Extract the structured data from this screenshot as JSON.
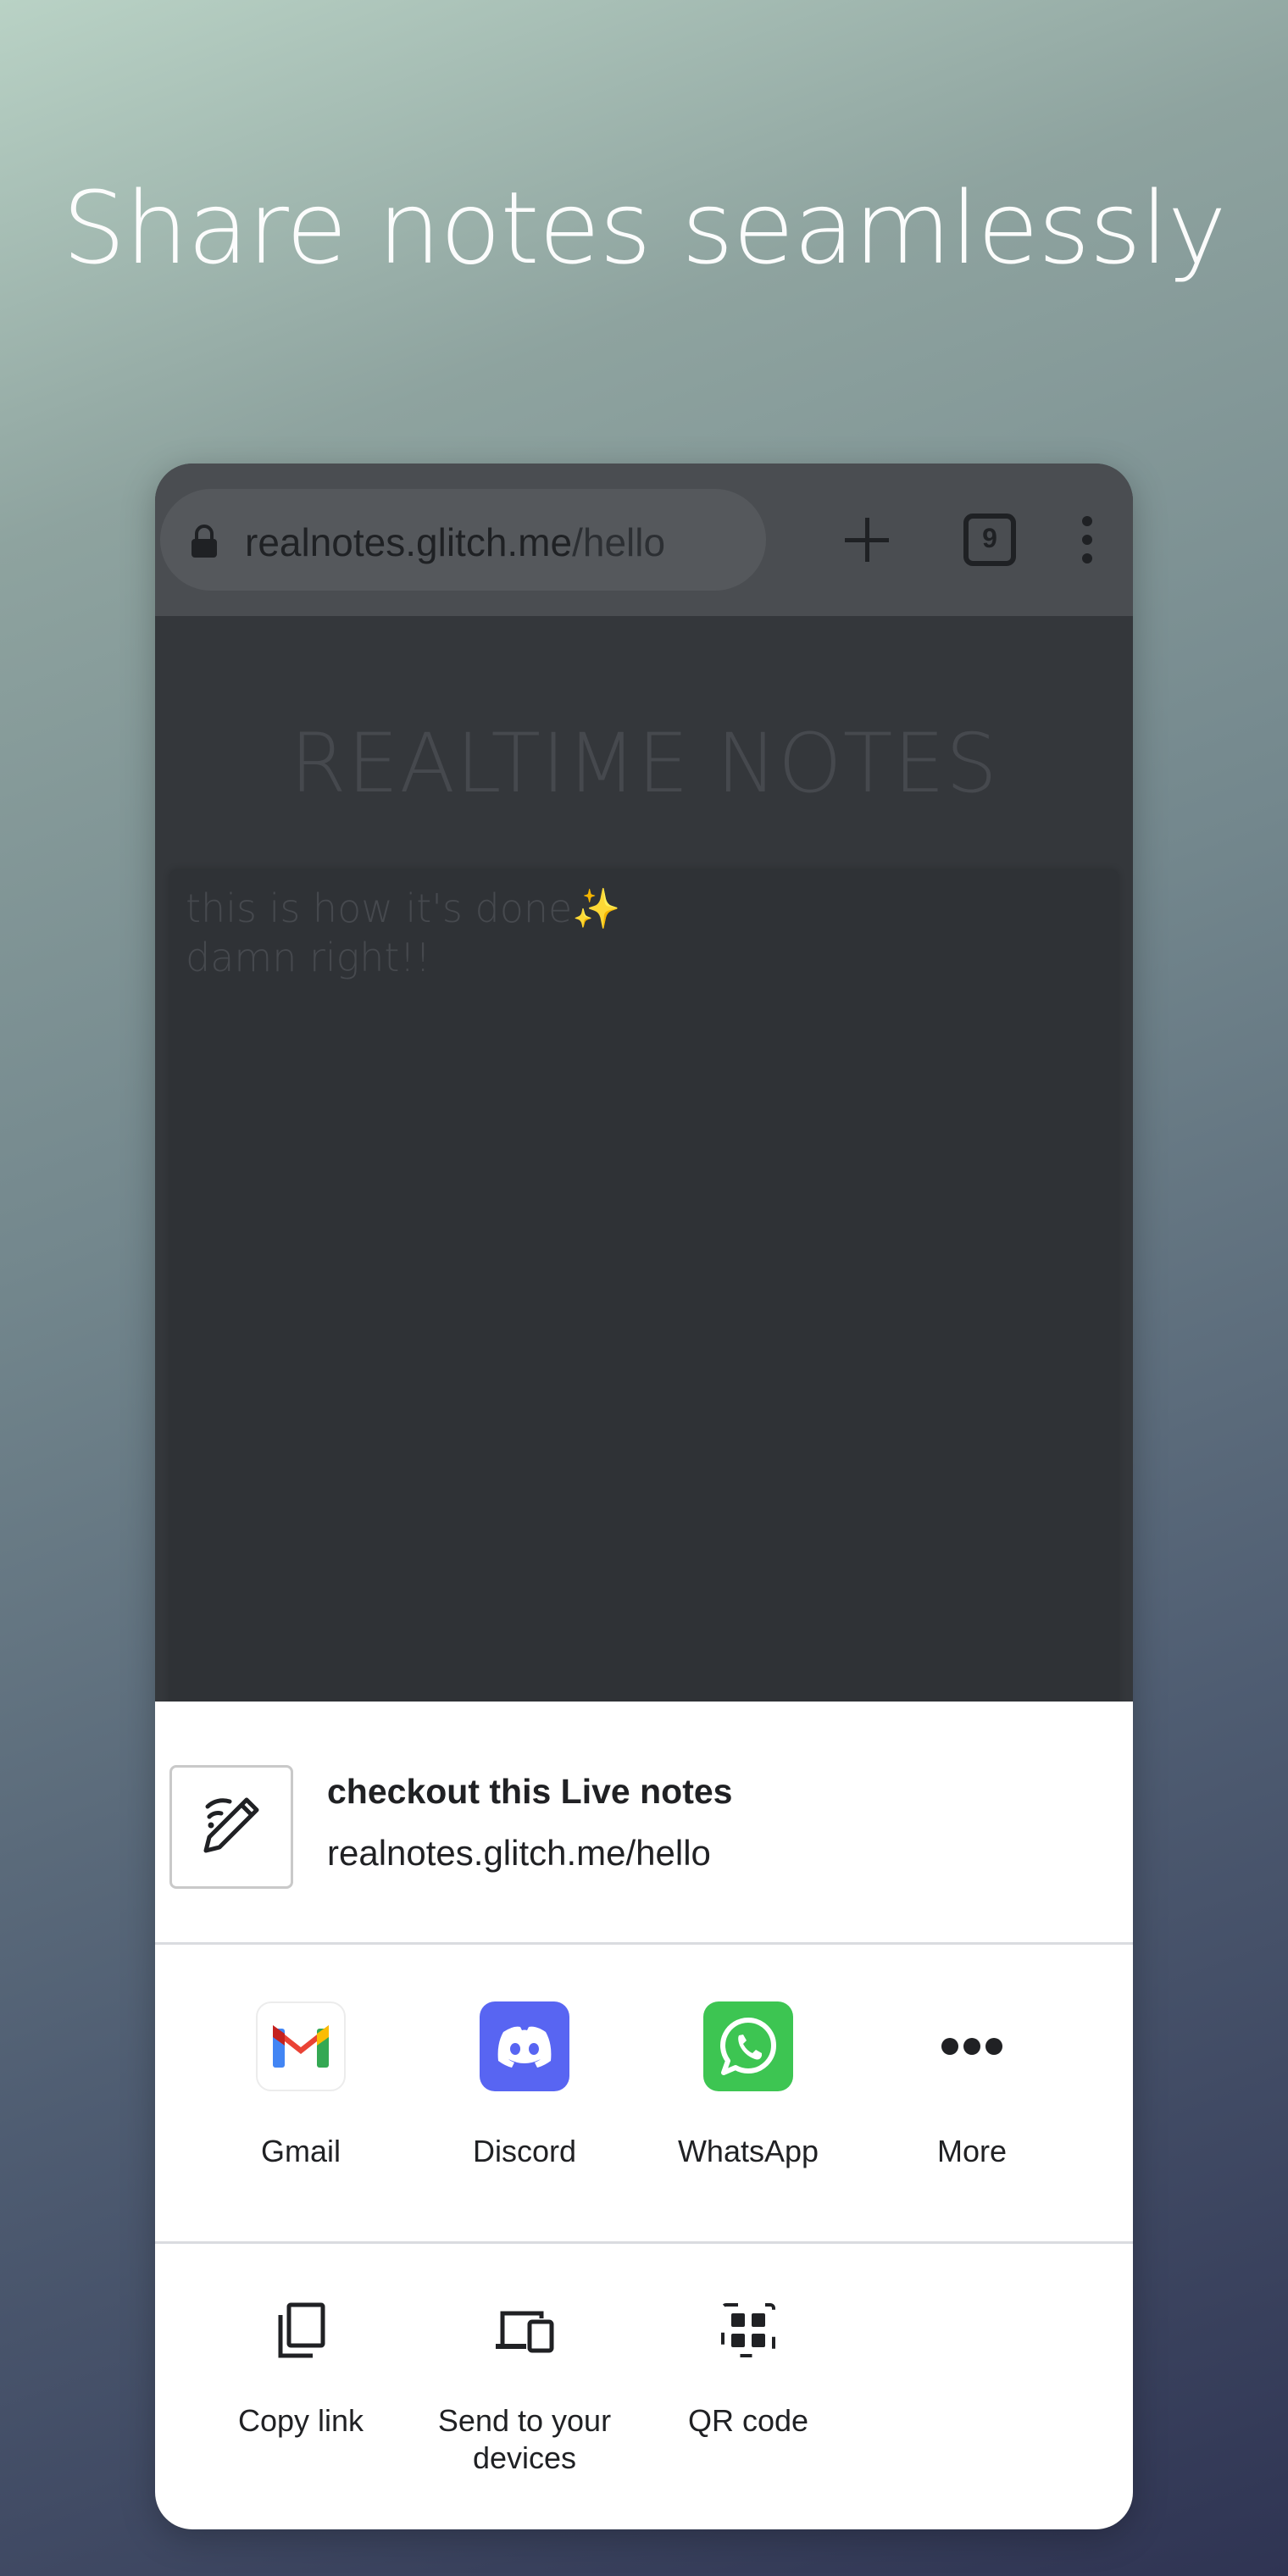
{
  "headline": "Share notes seamlessly",
  "browser": {
    "url_domain": "realnotes.glitch.me",
    "url_path": "/hello",
    "tab_count": "9",
    "icons": [
      "lock-icon",
      "new-tab-icon",
      "tab-switcher-icon",
      "overflow-menu-icon"
    ]
  },
  "page": {
    "title": "REALTIME NOTES",
    "note_lines": [
      "this is how it's done✨",
      "damn right!!"
    ]
  },
  "share_sheet": {
    "preview_title": "checkout this Live notes",
    "preview_url": "realnotes.glitch.me/hello",
    "apps": [
      {
        "label": "Gmail",
        "icon": "gmail-icon"
      },
      {
        "label": "Discord",
        "icon": "discord-icon",
        "color": "#5865F2"
      },
      {
        "label": "WhatsApp",
        "icon": "whatsapp-icon",
        "color": "#3dc552"
      },
      {
        "label": "More",
        "icon": "more-icon"
      }
    ],
    "actions": [
      {
        "label": "Copy link",
        "icon": "copy-icon"
      },
      {
        "label": "Send to your devices",
        "icon": "devices-icon"
      },
      {
        "label": "QR code",
        "icon": "qr-code-icon"
      }
    ]
  }
}
